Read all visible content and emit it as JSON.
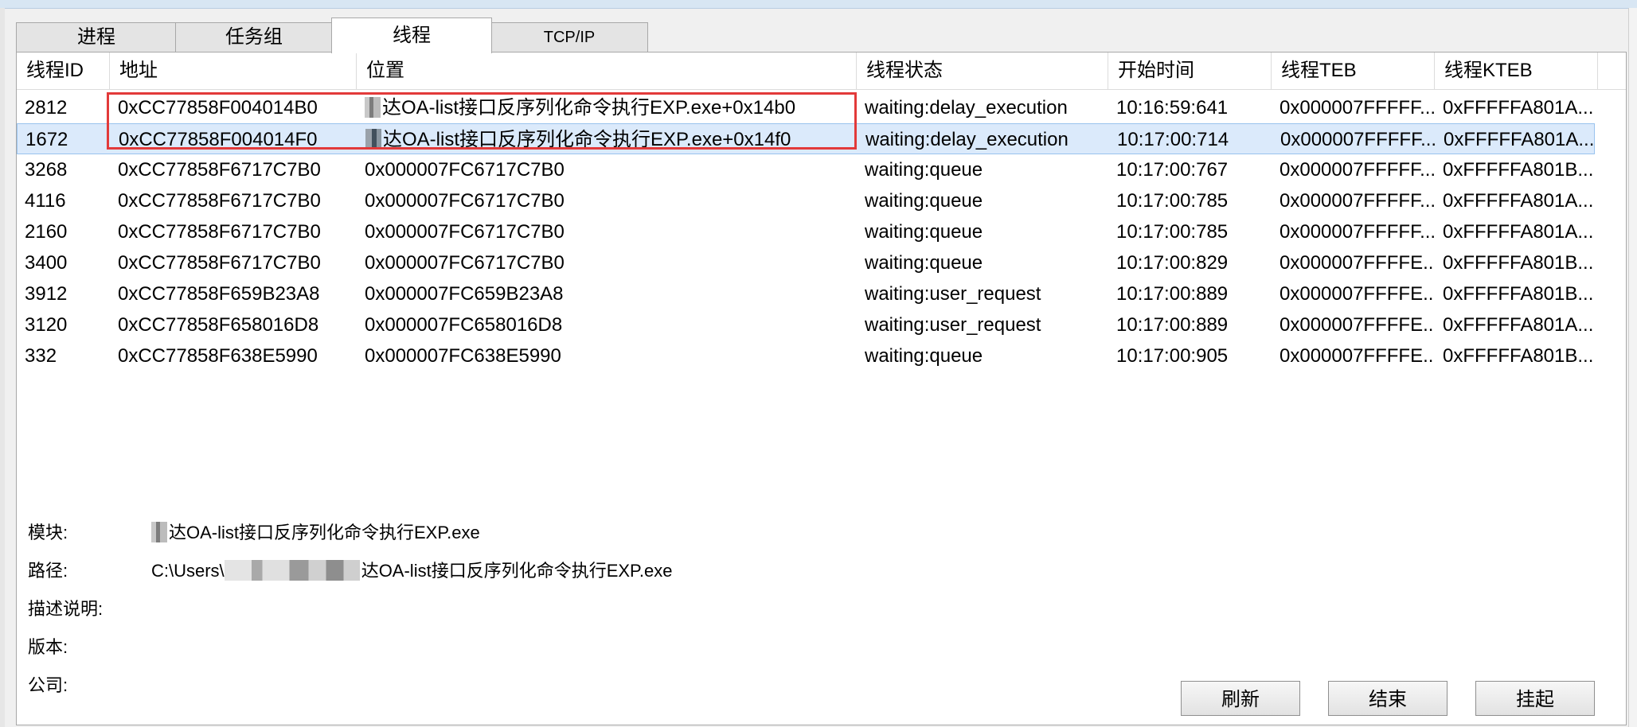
{
  "tabs": [
    {
      "label": "进程",
      "active": false
    },
    {
      "label": "任务组",
      "active": false
    },
    {
      "label": "线程",
      "active": true
    },
    {
      "label": "TCP/IP",
      "active": false
    }
  ],
  "table": {
    "columns": [
      "线程ID",
      "地址",
      "位置",
      "线程状态",
      "开始时间",
      "线程TEB",
      "线程KTEB"
    ],
    "rows": [
      {
        "id": "2812",
        "address": "0xCC77858F004014B0",
        "location": "达OA-list接口反序列化命令执行EXP.exe+0x14b0",
        "state": "waiting:delay_execution",
        "start": "10:16:59:641",
        "teb": "0x000007FFFFF...",
        "kteb": "0xFFFFFA801A..."
      },
      {
        "id": "1672",
        "address": "0xCC77858F004014F0",
        "location": "达OA-list接口反序列化命令执行EXP.exe+0x14f0",
        "state": "waiting:delay_execution",
        "start": "10:17:00:714",
        "teb": "0x000007FFFFF...",
        "kteb": "0xFFFFFA801A..."
      },
      {
        "id": "3268",
        "address": "0xCC77858F6717C7B0",
        "location": "0x000007FC6717C7B0",
        "state": "waiting:queue",
        "start": "10:17:00:767",
        "teb": "0x000007FFFFF...",
        "kteb": "0xFFFFFA801B..."
      },
      {
        "id": "4116",
        "address": "0xCC77858F6717C7B0",
        "location": "0x000007FC6717C7B0",
        "state": "waiting:queue",
        "start": "10:17:00:785",
        "teb": "0x000007FFFFF...",
        "kteb": "0xFFFFFA801A..."
      },
      {
        "id": "2160",
        "address": "0xCC77858F6717C7B0",
        "location": "0x000007FC6717C7B0",
        "state": "waiting:queue",
        "start": "10:17:00:785",
        "teb": "0x000007FFFFF...",
        "kteb": "0xFFFFFA801A..."
      },
      {
        "id": "3400",
        "address": "0xCC77858F6717C7B0",
        "location": "0x000007FC6717C7B0",
        "state": "waiting:queue",
        "start": "10:17:00:829",
        "teb": "0x000007FFFFE...",
        "kteb": "0xFFFFFA801B..."
      },
      {
        "id": "3912",
        "address": "0xCC77858F659B23A8",
        "location": "0x000007FC659B23A8",
        "state": "waiting:user_request",
        "start": "10:17:00:889",
        "teb": "0x000007FFFFE...",
        "kteb": "0xFFFFFA801B..."
      },
      {
        "id": "3120",
        "address": "0xCC77858F658016D8",
        "location": "0x000007FC658016D8",
        "state": "waiting:user_request",
        "start": "10:17:00:889",
        "teb": "0x000007FFFFE...",
        "kteb": "0xFFFFFA801A..."
      },
      {
        "id": "332",
        "address": "0xCC77858F638E5990",
        "location": "0x000007FC638E5990",
        "state": "waiting:queue",
        "start": "10:17:00:905",
        "teb": "0x000007FFFFE...",
        "kteb": "0xFFFFFA801B..."
      }
    ],
    "selected_row": 1
  },
  "details": {
    "module_label": "模块:",
    "module_value": "达OA-list接口反序列化命令执行EXP.exe",
    "path_label": "路径:",
    "path_prefix": "C:\\Users\\",
    "path_suffix": "达OA-list接口反序列化命令执行EXP.exe",
    "desc_label": "描述说明:",
    "version_label": "版本:",
    "company_label": "公司:"
  },
  "buttons": {
    "refresh": "刷新",
    "end": "结束",
    "suspend": "挂起"
  },
  "colors": {
    "selected_row": "#dbeafb",
    "highlight_box": "#e23a3a"
  }
}
